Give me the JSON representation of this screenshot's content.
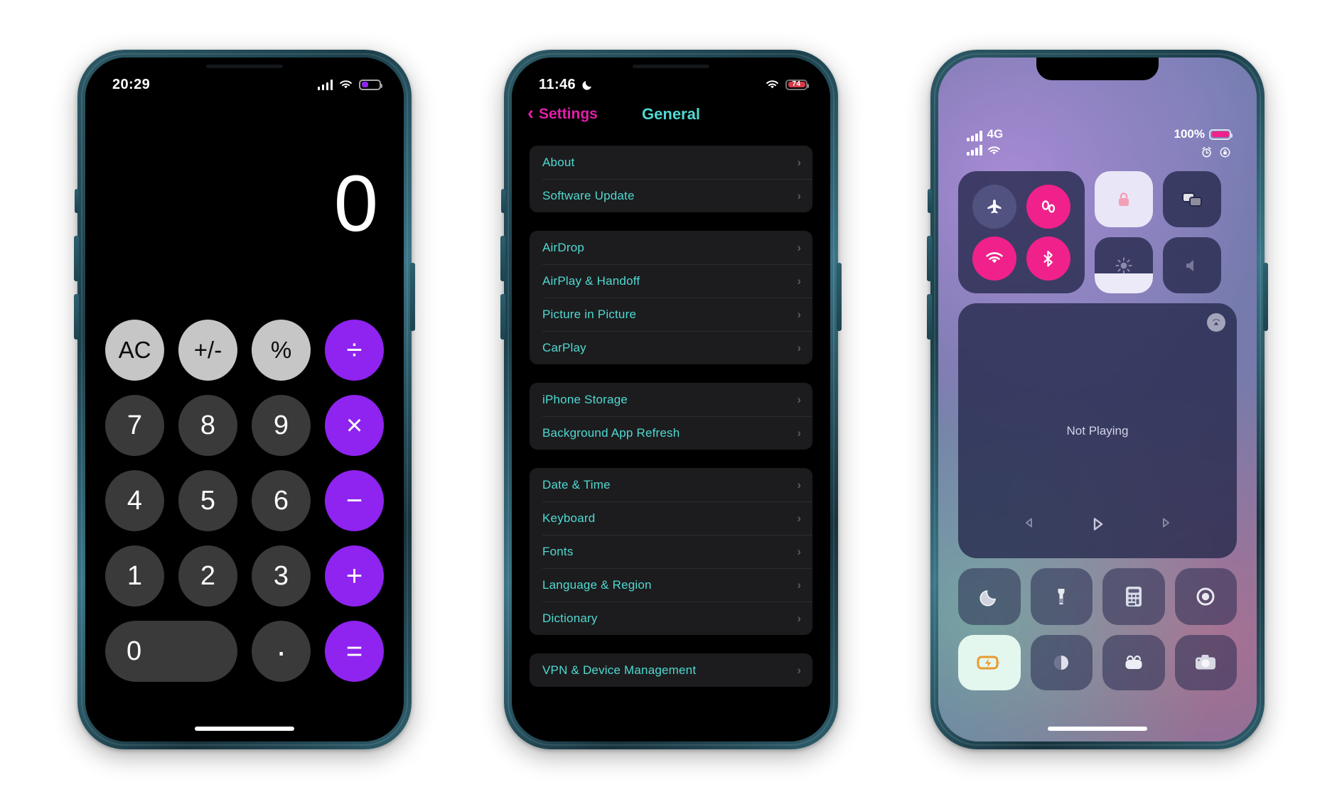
{
  "meta": {
    "scene": "three-iphone-mockups",
    "accent_purple": "#8f23ef",
    "accent_pink": "#f0218a",
    "accent_teal": "#4fd9d1",
    "accent_magenta": "#e21fa8"
  },
  "phone1": {
    "name": "calculator-phone",
    "status": {
      "time": "20:29",
      "signal_icon": "cellular-bars-icon",
      "wifi_icon": "wifi-icon",
      "battery_icon": "battery-icon",
      "battery_color": "#8f23ef"
    },
    "calculator": {
      "display_value": "0",
      "rows": [
        [
          {
            "label": "AC",
            "name": "all-clear-key",
            "kind": "fn"
          },
          {
            "label": "+/-",
            "name": "sign-toggle-key",
            "kind": "fn"
          },
          {
            "label": "%",
            "name": "percent-key",
            "kind": "fn"
          },
          {
            "label": "÷",
            "name": "divide-key",
            "kind": "op"
          }
        ],
        [
          {
            "label": "7",
            "name": "digit-7-key",
            "kind": "num"
          },
          {
            "label": "8",
            "name": "digit-8-key",
            "kind": "num"
          },
          {
            "label": "9",
            "name": "digit-9-key",
            "kind": "num"
          },
          {
            "label": "×",
            "name": "multiply-key",
            "kind": "op"
          }
        ],
        [
          {
            "label": "4",
            "name": "digit-4-key",
            "kind": "num"
          },
          {
            "label": "5",
            "name": "digit-5-key",
            "kind": "num"
          },
          {
            "label": "6",
            "name": "digit-6-key",
            "kind": "num"
          },
          {
            "label": "−",
            "name": "minus-key",
            "kind": "op"
          }
        ],
        [
          {
            "label": "1",
            "name": "digit-1-key",
            "kind": "num"
          },
          {
            "label": "2",
            "name": "digit-2-key",
            "kind": "num"
          },
          {
            "label": "3",
            "name": "digit-3-key",
            "kind": "num"
          },
          {
            "label": "+",
            "name": "plus-key",
            "kind": "op"
          }
        ],
        [
          {
            "label": "0",
            "name": "digit-0-key",
            "kind": "wide"
          },
          {
            "label": "·",
            "name": "decimal-point-key",
            "kind": "dot"
          },
          {
            "label": "=",
            "name": "equals-key",
            "kind": "op"
          }
        ]
      ]
    }
  },
  "phone2": {
    "name": "settings-general-phone",
    "status": {
      "time": "11:46",
      "moon_icon": "crescent-moon-icon",
      "wifi_icon": "wifi-icon",
      "battery_value": "74",
      "battery_state": "charging",
      "battery_color": "#d63b4a"
    },
    "nav": {
      "back_label": "Settings",
      "back_icon": "chevron-left-icon",
      "title": "General"
    },
    "groups": [
      {
        "items": [
          {
            "label": "About",
            "name": "settings-row-about"
          },
          {
            "label": "Software Update",
            "name": "settings-row-software-update"
          }
        ]
      },
      {
        "items": [
          {
            "label": "AirDrop",
            "name": "settings-row-airdrop"
          },
          {
            "label": "AirPlay & Handoff",
            "name": "settings-row-airplay-handoff"
          },
          {
            "label": "Picture in Picture",
            "name": "settings-row-picture-in-picture"
          },
          {
            "label": "CarPlay",
            "name": "settings-row-carplay"
          }
        ]
      },
      {
        "items": [
          {
            "label": "iPhone Storage",
            "name": "settings-row-iphone-storage"
          },
          {
            "label": "Background App Refresh",
            "name": "settings-row-background-app-refresh"
          }
        ]
      },
      {
        "items": [
          {
            "label": "Date & Time",
            "name": "settings-row-date-time"
          },
          {
            "label": "Keyboard",
            "name": "settings-row-keyboard"
          },
          {
            "label": "Fonts",
            "name": "settings-row-fonts"
          },
          {
            "label": "Language & Region",
            "name": "settings-row-language-region"
          },
          {
            "label": "Dictionary",
            "name": "settings-row-dictionary"
          }
        ]
      },
      {
        "items": [
          {
            "label": "VPN & Device Management",
            "name": "settings-row-vpn-device-management"
          }
        ]
      }
    ],
    "chevron_glyph": "›"
  },
  "phone3": {
    "name": "control-center-phone",
    "status": {
      "network_label": "4G",
      "signal_icon": "cellular-bars-icon",
      "signal2_icon": "cellular-bars-icon",
      "wifi_icon": "wifi-icon",
      "battery_percent": "100%",
      "battery_color": "#f0218a",
      "alarm_icon": "alarm-clock-icon",
      "rotation_lock_icon": "rotation-lock-icon"
    },
    "connectivity": [
      {
        "name": "airplane-mode-toggle",
        "icon": "airplane-icon",
        "state": "off"
      },
      {
        "name": "cellular-data-toggle",
        "icon": "cellular-data-icon",
        "state": "on"
      },
      {
        "name": "wifi-toggle",
        "icon": "wifi-icon",
        "state": "on"
      },
      {
        "name": "bluetooth-toggle",
        "icon": "bluetooth-icon",
        "state": "on"
      }
    ],
    "tiles_right": [
      {
        "name": "orientation-lock-toggle",
        "icon": "rotation-lock-icon",
        "state": "on"
      },
      {
        "name": "screen-mirroring-button",
        "icon": "screen-mirroring-icon",
        "state": "off"
      },
      {
        "name": "brightness-slider",
        "icon": "brightness-icon",
        "state": "slider",
        "level": "36"
      },
      {
        "name": "volume-slider",
        "icon": "volume-icon",
        "state": "off",
        "level": "0"
      }
    ],
    "media": {
      "title": "Not Playing",
      "airplay_icon": "airplay-icon",
      "controls": [
        {
          "name": "previous-track-button",
          "icon": "rewind-icon"
        },
        {
          "name": "play-button",
          "icon": "play-icon"
        },
        {
          "name": "next-track-button",
          "icon": "forward-icon"
        }
      ]
    },
    "grid": [
      {
        "name": "focus-dnd-button",
        "icon": "moon-icon",
        "active": false
      },
      {
        "name": "flashlight-button",
        "icon": "flashlight-icon",
        "active": false
      },
      {
        "name": "calculator-button",
        "icon": "calculator-icon",
        "active": false
      },
      {
        "name": "screen-record-button",
        "icon": "screen-record-icon",
        "active": false
      },
      {
        "name": "low-power-mode-button",
        "icon": "battery-bolt-icon",
        "active": true
      },
      {
        "name": "dark-mode-button",
        "icon": "dark-mode-icon",
        "active": false
      },
      {
        "name": "wallet-button",
        "icon": "wallet-icon",
        "active": false
      },
      {
        "name": "camera-button",
        "icon": "camera-icon",
        "active": false
      }
    ]
  }
}
